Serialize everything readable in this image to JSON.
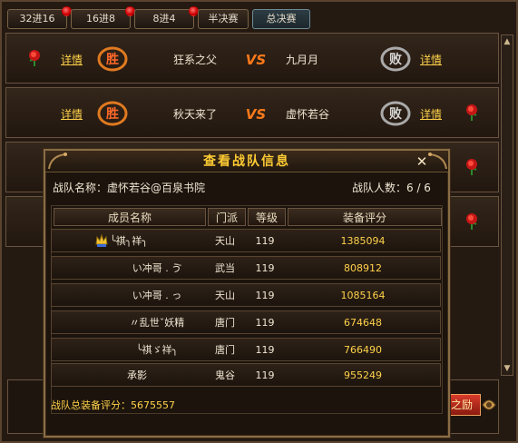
{
  "tabs": [
    {
      "label": "32进16",
      "has_dot": true
    },
    {
      "label": "16进8",
      "has_dot": true
    },
    {
      "label": "8进4",
      "has_dot": true
    },
    {
      "label": "半决赛",
      "has_dot": false
    },
    {
      "label": "总决赛",
      "has_dot": false
    }
  ],
  "matches": [
    {
      "left_link": "详情",
      "left_name": "狂系之父",
      "right_name": "九月月",
      "right_link": "详情"
    },
    {
      "left_link": "详情",
      "left_name": "秋天来了",
      "right_name": "虚怀若谷",
      "right_link": "详情"
    }
  ],
  "badges": {
    "win": "胜",
    "lose": "败",
    "vs": "VS"
  },
  "dialog": {
    "title": "查看战队信息",
    "close": "✕",
    "team_name_label": "战队名称：虚怀若谷@百泉书院",
    "member_count_label": "战队人数：6 / 6",
    "columns": [
      "成员名称",
      "门派",
      "等级",
      "装备评分"
    ],
    "members": [
      {
        "name": "╰祺╮祥╮",
        "sect": "天山",
        "level": "119",
        "score": "1385094",
        "leader": true
      },
      {
        "name": "い冲哥 . ゔ",
        "sect": "武当",
        "level": "119",
        "score": "808912",
        "leader": false
      },
      {
        "name": "い冲哥 . っ",
        "sect": "天山",
        "level": "119",
        "score": "1085164",
        "leader": false
      },
      {
        "name": "〃乱世ˇ妖精",
        "sect": "唐门",
        "level": "119",
        "score": "674648",
        "leader": false
      },
      {
        "name": "╰祺ゞ祥╮",
        "sect": "唐门",
        "level": "119",
        "score": "766490",
        "leader": false
      },
      {
        "name": "承影",
        "sect": "鬼谷",
        "level": "119",
        "score": "955249",
        "leader": false
      }
    ],
    "total_label": "战队总装备评分：5675557"
  },
  "bottom_button": "之励",
  "colors": {
    "gold": "#ffd24a",
    "rose": "#d01818",
    "accent": "#ffcc33"
  }
}
